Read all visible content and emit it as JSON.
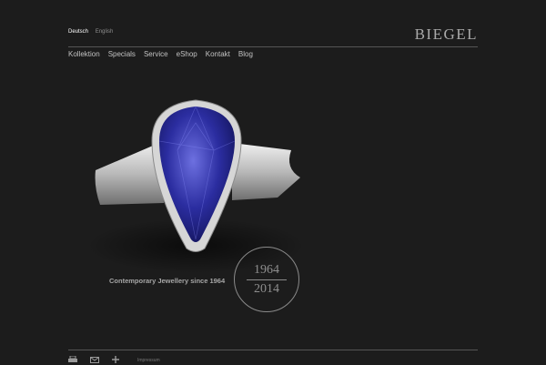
{
  "language": {
    "active": "Deutsch",
    "other": "English"
  },
  "brand": {
    "logo": "BIEGEL"
  },
  "nav": [
    "Kollektion",
    "Specials",
    "Service",
    "eShop",
    "Kontakt",
    "Blog"
  ],
  "hero": {
    "tagline": "Contemporary Jewellery since 1964",
    "anniversary_start": "1964",
    "anniversary_end": "2014"
  },
  "footer": {
    "icons": [
      "print-icon",
      "mail-icon",
      "plus-icon"
    ],
    "link": "Impressum"
  },
  "colors": {
    "background": "#1c1c1c",
    "gem": "#2b2da0",
    "metal": "#cfcfcf"
  }
}
